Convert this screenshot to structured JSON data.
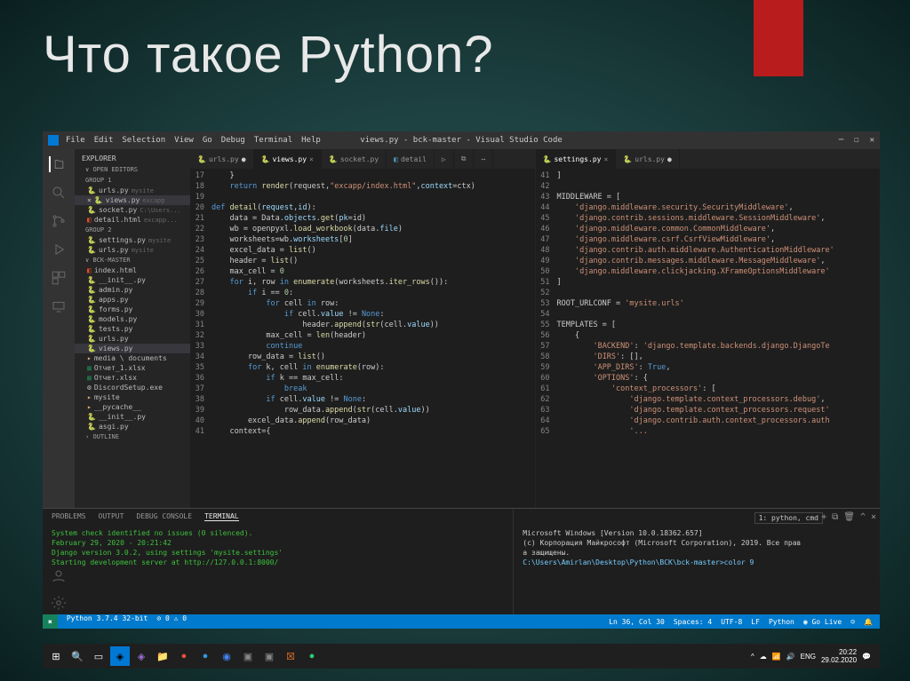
{
  "slide": {
    "title": "Что такое Python?"
  },
  "titlebar": {
    "text": "views.py - bck-master - Visual Studio Code",
    "menu": [
      "File",
      "Edit",
      "Selection",
      "View",
      "Go",
      "Debug",
      "Terminal",
      "Help"
    ]
  },
  "sidebar": {
    "header": "EXPLORER",
    "open_editors": "OPEN EDITORS",
    "group1": "GROUP 1",
    "group2": "GROUP 2",
    "items1": [
      {
        "icon": "py",
        "name": "urls.py",
        "dim": "mysite"
      },
      {
        "icon": "py",
        "name": "views.py",
        "dim": "excapp",
        "sel": true,
        "close": "×"
      },
      {
        "icon": "py",
        "name": "socket.py",
        "dim": "C:\\Users..."
      },
      {
        "icon": "html",
        "name": "detail.html",
        "dim": "excapp..."
      }
    ],
    "items2": [
      {
        "icon": "py",
        "name": "settings.py",
        "dim": "mysite"
      },
      {
        "icon": "py",
        "name": "urls.py",
        "dim": "mysite"
      }
    ],
    "workspace": "BCK-MASTER",
    "files": [
      {
        "icon": "html",
        "name": "index.html"
      },
      {
        "icon": "py",
        "name": "__init__.py"
      },
      {
        "icon": "py",
        "name": "admin.py"
      },
      {
        "icon": "py",
        "name": "apps.py"
      },
      {
        "icon": "py",
        "name": "forms.py"
      },
      {
        "icon": "py",
        "name": "models.py"
      },
      {
        "icon": "py",
        "name": "tests.py"
      },
      {
        "icon": "py",
        "name": "urls.py"
      },
      {
        "icon": "py",
        "name": "views.py",
        "sel": true
      }
    ],
    "folders": [
      {
        "icon": "folder",
        "name": "media \\ documents"
      }
    ],
    "misc": [
      {
        "icon": "xlsx",
        "name": "Отчет_1.xlsx"
      },
      {
        "icon": "xlsx",
        "name": "Отчет.xlsx"
      },
      {
        "icon": "exe",
        "name": "DiscordSetup.exe"
      }
    ],
    "mysite": "mysite",
    "mysite_items": [
      {
        "icon": "folder",
        "name": "__pycache__"
      },
      {
        "icon": "py",
        "name": "__init__.py"
      },
      {
        "icon": "py",
        "name": "asgi.py"
      }
    ],
    "outline": "OUTLINE"
  },
  "tabs_left": [
    {
      "icon": "py",
      "name": "urls.py",
      "dot": "●"
    },
    {
      "icon": "py",
      "name": "views.py",
      "active": true,
      "close": "×"
    },
    {
      "icon": "py",
      "name": "socket.py"
    },
    {
      "icon": "html",
      "name": "detail"
    }
  ],
  "tabs_right": [
    {
      "icon": "py",
      "name": "settings.py",
      "active": true,
      "close": "×"
    },
    {
      "icon": "py",
      "name": "urls.py",
      "dot": "●"
    }
  ],
  "code_left": [
    {
      "n": 17,
      "html": "    <span class='op'>}</span>"
    },
    {
      "n": 18,
      "html": "    <span class='kw'>return</span> <span class='fn'>render</span>(request,<span class='st'>\"excapp/index.html\"</span>,<span class='pr'>context</span>=ctx)"
    },
    {
      "n": 19,
      "html": ""
    },
    {
      "n": 20,
      "html": "<span class='kw'>def</span> <span class='fn'>detail</span>(<span class='pr'>request</span>,<span class='pr'>id</span>):"
    },
    {
      "n": 21,
      "html": "    data = Data.<span class='pr'>objects</span>.<span class='fn'>get</span>(<span class='pr'>pk</span>=id)"
    },
    {
      "n": 22,
      "html": "    wb = openpyxl.<span class='fn'>load_workbook</span>(data.<span class='pr'>file</span>)"
    },
    {
      "n": 23,
      "html": "    worksheets=wb.<span class='pr'>worksheets</span>[<span class='nm'>0</span>]"
    },
    {
      "n": 24,
      "html": "    excel_data = <span class='fn'>list</span>()"
    },
    {
      "n": 25,
      "html": "    header = <span class='fn'>list</span>()"
    },
    {
      "n": 26,
      "html": "    max_cell = <span class='nm'>0</span>"
    },
    {
      "n": 27,
      "html": "    <span class='kw'>for</span> i, row <span class='kw'>in</span> <span class='fn'>enumerate</span>(worksheets.<span class='fn'>iter_rows</span>()):"
    },
    {
      "n": 28,
      "html": "        <span class='kw'>if</span> i == <span class='nm'>0</span>:"
    },
    {
      "n": 29,
      "html": "            <span class='kw'>for</span> cell <span class='kw'>in</span> row:"
    },
    {
      "n": 30,
      "html": "                <span class='kw'>if</span> cell.<span class='pr'>value</span> != <span class='kw'>None</span>:"
    },
    {
      "n": 31,
      "html": "                    header.<span class='fn'>append</span>(<span class='fn'>str</span>(cell.<span class='pr'>value</span>))"
    },
    {
      "n": 32,
      "html": "            max_cell = <span class='fn'>len</span>(header)"
    },
    {
      "n": 33,
      "html": "            <span class='kw'>continue</span>"
    },
    {
      "n": 34,
      "html": "        row_data = <span class='fn'>list</span>()"
    },
    {
      "n": 35,
      "html": "        <span class='kw'>for</span> k, cell <span class='kw'>in</span> <span class='fn'>enumerate</span>(row):"
    },
    {
      "n": 36,
      "html": "            <span class='kw'>if</span> k == max_cell:"
    },
    {
      "n": 37,
      "html": "                <span class='kw'>break</span>"
    },
    {
      "n": 38,
      "html": "            <span class='kw'>if</span> cell.<span class='pr'>value</span> != <span class='kw'>None</span>:"
    },
    {
      "n": 39,
      "html": "                row_data.<span class='fn'>append</span>(<span class='fn'>str</span>(cell.<span class='pr'>value</span>))"
    },
    {
      "n": 40,
      "html": "        excel_data.<span class='fn'>append</span>(row_data)"
    },
    {
      "n": 41,
      "html": "    context={"
    }
  ],
  "code_right": [
    {
      "n": 41,
      "html": "<span class='op'>]</span>"
    },
    {
      "n": 42,
      "html": ""
    },
    {
      "n": 43,
      "html": "MIDDLEWARE = ["
    },
    {
      "n": 44,
      "html": "    <span class='st'>'django.middleware.security.SecurityMiddleware'</span>,"
    },
    {
      "n": 45,
      "html": "    <span class='st'>'django.contrib.sessions.middleware.SessionMiddleware'</span>,"
    },
    {
      "n": 46,
      "html": "    <span class='st'>'django.middleware.common.CommonMiddleware'</span>,"
    },
    {
      "n": 47,
      "html": "    <span class='st'>'django.middleware.csrf.CsrfViewMiddleware'</span>,"
    },
    {
      "n": 48,
      "html": "    <span class='st'>'django.contrib.auth.middleware.AuthenticationMiddleware'</span>"
    },
    {
      "n": 49,
      "html": "    <span class='st'>'django.contrib.messages.middleware.MessageMiddleware'</span>,"
    },
    {
      "n": 50,
      "html": "    <span class='st'>'django.middleware.clickjacking.XFrameOptionsMiddleware'</span>"
    },
    {
      "n": 51,
      "html": "<span class='op'>]</span>"
    },
    {
      "n": 52,
      "html": ""
    },
    {
      "n": 53,
      "html": "ROOT_URLCONF = <span class='st'>'mysite.urls'</span>"
    },
    {
      "n": 54,
      "html": ""
    },
    {
      "n": 55,
      "html": "TEMPLATES = ["
    },
    {
      "n": 56,
      "html": "    {"
    },
    {
      "n": 57,
      "html": "        <span class='st'>'BACKEND'</span>: <span class='st'>'django.template.backends.django.DjangoTe</span>"
    },
    {
      "n": 58,
      "html": "        <span class='st'>'DIRS'</span>: [],"
    },
    {
      "n": 59,
      "html": "        <span class='st'>'APP_DIRS'</span>: <span class='kw'>True</span>,"
    },
    {
      "n": 60,
      "html": "        <span class='st'>'OPTIONS'</span>: {"
    },
    {
      "n": 61,
      "html": "            <span class='st'>'context_processors'</span>: ["
    },
    {
      "n": 62,
      "html": "                <span class='st'>'django.template.context_processors.debug'</span>,"
    },
    {
      "n": 63,
      "html": "                <span class='st'>'django.template.context_processors.request'</span>"
    },
    {
      "n": 64,
      "html": "                <span class='st'>'django.contrib.auth.context_processors.auth</span>"
    },
    {
      "n": 65,
      "html": "                <span class='st'>'...</span>"
    }
  ],
  "panel": {
    "tabs": [
      "PROBLEMS",
      "OUTPUT",
      "DEBUG CONSOLE",
      "TERMINAL"
    ],
    "active_tab": 3,
    "left_lines": [
      {
        "cls": "ok",
        "t": "System check identified no issues (0 silenced)."
      },
      {
        "cls": "ok",
        "t": "February 29, 2020 - 20:21:42"
      },
      {
        "cls": "ok",
        "t": "Django version 3.0.2, using settings 'mysite.settings'"
      },
      {
        "cls": "ok",
        "t": "Starting development server at http://127.0.0.1:8000/"
      }
    ],
    "dropdown": "1: python, cmd",
    "right_lines": [
      {
        "t": "Microsoft Windows [Version 10.0.18362.657]"
      },
      {
        "t": "(c) Корпорация Майкрософт (Microsoft Corporation), 2019. Все прав"
      },
      {
        "t": "а защищены."
      },
      {
        "t": ""
      },
      {
        "cls": "prompt",
        "t": "C:\\Users\\Amirlan\\Desktop\\Python\\BCK\\bck-master>color 9"
      }
    ]
  },
  "statusbar": {
    "left": [
      "Python 3.7.4 32-bit",
      "⊘ 0 ⚠ 0"
    ],
    "right": [
      "Ln 36, Col 30",
      "Spaces: 4",
      "UTF-8",
      "LF",
      "Python",
      "◉ Go Live",
      "☺",
      "🔔"
    ],
    "pyver": "✖"
  },
  "taskbar": {
    "time": "20:22",
    "date": "29.02.2020",
    "lang": "ENG"
  }
}
